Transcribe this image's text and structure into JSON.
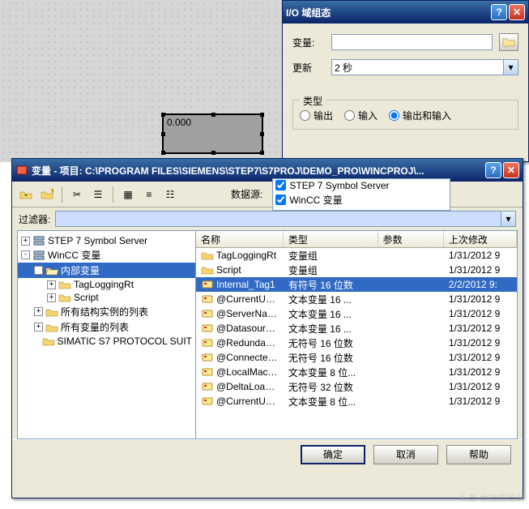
{
  "canvas": {
    "field_value": "0.000"
  },
  "io_dialog": {
    "title": "I/O 域组态",
    "var_label": "变量:",
    "var_value": "",
    "update_label": "更新",
    "update_value": "2 秒",
    "type_group": "类型",
    "opt_output": "输出",
    "opt_input": "输入",
    "opt_both": "输出和输入"
  },
  "var_dialog": {
    "title": "变量 - 项目: C:\\PROGRAM FILES\\SIEMENS\\STEP7\\S7PROJ\\DEMO_PRO\\WINCPROJ\\...",
    "data_source_label": "数据源:",
    "src_step7": "STEP 7 Symbol Server",
    "src_wincc": "WinCC 变量",
    "filter_label": "过滤器:",
    "filter_value": "",
    "tree": [
      {
        "indent": 0,
        "pm": "+",
        "icon": "server",
        "label": "STEP 7 Symbol Server",
        "sel": false
      },
      {
        "indent": 0,
        "pm": "-",
        "icon": "server",
        "label": "WinCC 变量",
        "sel": false
      },
      {
        "indent": 1,
        "pm": "-",
        "icon": "folder-open",
        "label": "内部变量",
        "sel": true
      },
      {
        "indent": 2,
        "pm": "+",
        "icon": "folder",
        "label": "TagLoggingRt",
        "sel": false
      },
      {
        "indent": 2,
        "pm": "+",
        "icon": "folder",
        "label": "Script",
        "sel": false
      },
      {
        "indent": 1,
        "pm": "+",
        "icon": "folder",
        "label": "所有结构实例的列表",
        "sel": false
      },
      {
        "indent": 1,
        "pm": "+",
        "icon": "folder",
        "label": "所有变量的列表",
        "sel": false
      },
      {
        "indent": 1,
        "pm": " ",
        "icon": "folder",
        "label": "SIMATIC S7 PROTOCOL SUIT",
        "sel": false
      }
    ],
    "columns": {
      "name": "名称",
      "type": "类型",
      "param": "参数",
      "date": "上次修改"
    },
    "rows": [
      {
        "icon": "folder",
        "name": "TagLoggingRt",
        "type": "变量组",
        "param": "",
        "date": "1/31/2012 9",
        "sel": false
      },
      {
        "icon": "folder",
        "name": "Script",
        "type": "变量组",
        "param": "",
        "date": "1/31/2012 9",
        "sel": false
      },
      {
        "icon": "tag",
        "name": "Internal_Tag1",
        "type": "有符号 16 位数",
        "param": "",
        "date": "2/2/2012 9:",
        "sel": true
      },
      {
        "icon": "tag",
        "name": "@CurrentUse...",
        "type": "文本变量 16 ...",
        "param": "",
        "date": "1/31/2012 9",
        "sel": false
      },
      {
        "icon": "tag",
        "name": "@ServerName",
        "type": "文本变量 16 ...",
        "param": "",
        "date": "1/31/2012 9",
        "sel": false
      },
      {
        "icon": "tag",
        "name": "@Datasource...",
        "type": "文本变量 16 ...",
        "param": "",
        "date": "1/31/2012 9",
        "sel": false
      },
      {
        "icon": "tag",
        "name": "@Redundant...",
        "type": "无符号 16 位数",
        "param": "",
        "date": "1/31/2012 9",
        "sel": false
      },
      {
        "icon": "tag",
        "name": "@Connected...",
        "type": "无符号 16 位数",
        "param": "",
        "date": "1/31/2012 9",
        "sel": false
      },
      {
        "icon": "tag",
        "name": "@LocalMachi...",
        "type": "文本变量 8 位...",
        "param": "",
        "date": "1/31/2012 9",
        "sel": false
      },
      {
        "icon": "tag",
        "name": "@DeltaLoaded",
        "type": "无符号 32 位数",
        "param": "",
        "date": "1/31/2012 9",
        "sel": false
      },
      {
        "icon": "tag",
        "name": "@CurrentUser",
        "type": "文本变量 8 位...",
        "param": "",
        "date": "1/31/2012 9",
        "sel": false
      }
    ],
    "ok": "确定",
    "cancel": "取消",
    "help": "帮助"
  },
  "watermark": "头条 @技成培训"
}
